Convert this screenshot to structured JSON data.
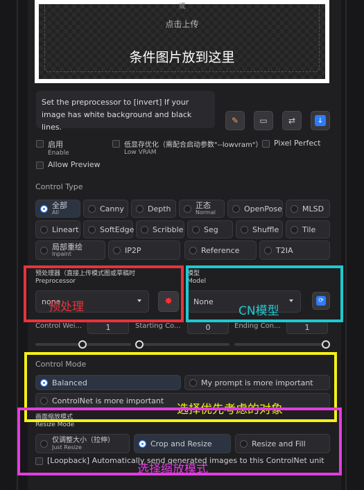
{
  "image_input": {
    "or_text": "或",
    "click_upload": "点击上传",
    "overlay_note": "条件图片放到这里"
  },
  "info": {
    "text": "Set the preprocessor to [invert] If your image has white background and black lines."
  },
  "tool_buttons": [
    "edit-icon",
    "camera-icon",
    "swap-icon",
    "send-icon"
  ],
  "options": {
    "enable": {
      "label": "启用",
      "sub": "Enable"
    },
    "low_vram": {
      "label": "低显存优化（需配合启动参数\"--lowvram\"）",
      "sub": "Low VRAM"
    },
    "pixel_perfect": {
      "label": "Pixel Perfect"
    },
    "allow_preview": {
      "label": "Allow Preview"
    }
  },
  "control_type": {
    "label": "Control Type",
    "items": [
      {
        "label": "全部",
        "sub": "All",
        "selected": true
      },
      {
        "label": "Canny"
      },
      {
        "label": "Depth"
      },
      {
        "label": "正态",
        "sub": "Normal"
      },
      {
        "label": "OpenPose"
      },
      {
        "label": "MLSD"
      },
      {
        "label": "Lineart"
      },
      {
        "label": "SoftEdge"
      },
      {
        "label": "Scribble"
      },
      {
        "label": "Seg"
      },
      {
        "label": "Shuffle"
      },
      {
        "label": "Tile"
      },
      {
        "label": "局部重绘",
        "sub": "Inpaint"
      },
      {
        "label": "IP2P"
      },
      {
        "label": "Reference"
      },
      {
        "label": "T2IA"
      }
    ]
  },
  "preprocessor": {
    "label": "预处理器（直接上传模式图或草稿时",
    "sub": "Preprocessor",
    "value": "none",
    "annotation": "预处理"
  },
  "model": {
    "label": "模型",
    "sub": "Model",
    "value": "None",
    "annotation": "CN模型"
  },
  "sliders": {
    "control_weight": {
      "label": "Control Wei...",
      "value": "1"
    },
    "starting": {
      "label": "Starting Co...",
      "value": "0"
    },
    "ending": {
      "label": "Ending Con...",
      "value": "1"
    }
  },
  "control_mode": {
    "label": "Control Mode",
    "balanced": "Balanced",
    "prompt": "My prompt is more important",
    "controlnet": "ControlNet is more important",
    "annotation": "选择优先考虑的对象"
  },
  "resize_mode": {
    "label": "画面缩放模式",
    "sub": "Resize Mode",
    "just_resize": "仅调整大小（拉伸）",
    "just_resize_sub": "Just Resize",
    "crop_resize": "Crop and Resize",
    "resize_fill": "Resize and Fill",
    "loopback": "[Loopback] Automatically send generated images to this ControlNet unit",
    "annotation": "选择缩放模式"
  },
  "colors": {
    "red_box": "#e8333a",
    "cyan_box": "#20c9cf",
    "yellow_box": "#f5f019",
    "magenta_box": "#e43ce0"
  }
}
